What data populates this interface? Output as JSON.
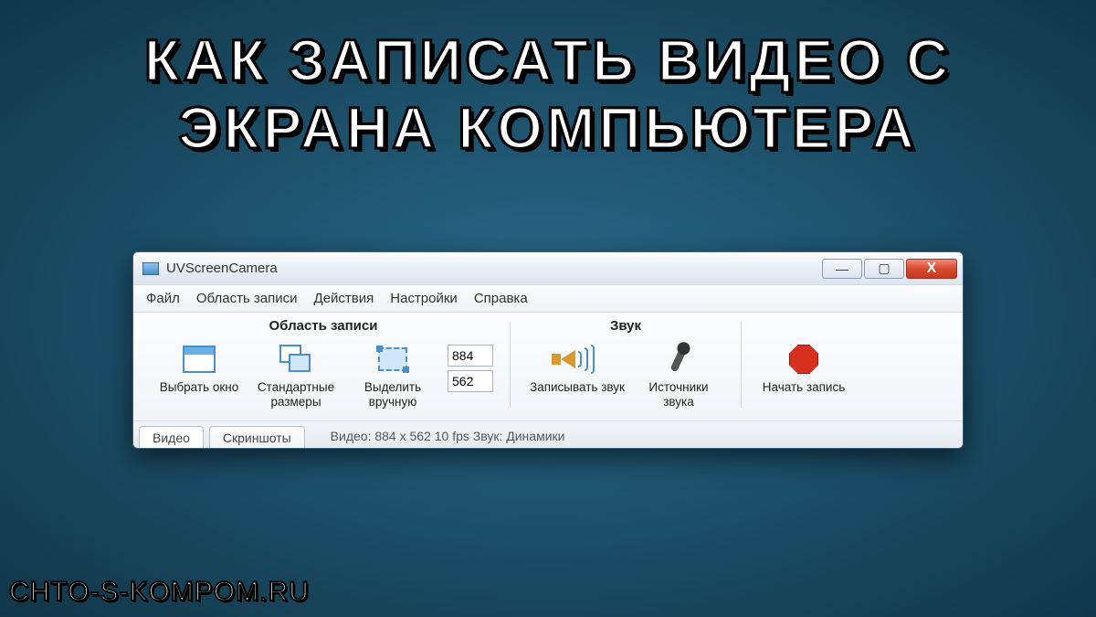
{
  "headline": "КАК ЗАПИСАТЬ ВИДЕО С ЭКРАНА КОМПЬЮТЕРА",
  "watermark": "CHTO-S-KOMPOM.RU",
  "window": {
    "title": "UVScreenCamera",
    "menu": [
      "Файл",
      "Область записи",
      "Действия",
      "Настройки",
      "Справка"
    ],
    "groups": {
      "area": {
        "title": "Область записи",
        "select_window": "Выбрать окно",
        "standard_sizes": "Стандартные размеры",
        "select_manual": "Выделить вручную",
        "width": "884",
        "height": "562"
      },
      "sound": {
        "title": "Звук",
        "record_sound": "Записывать звук",
        "sound_sources": "Источники звука"
      },
      "action": {
        "start_record": "Начать запись"
      }
    },
    "tabs": {
      "video": "Видео",
      "screenshots": "Скриншоты"
    },
    "status": "Видео: 884 x 562  10 fps   Звук: Динамики"
  }
}
